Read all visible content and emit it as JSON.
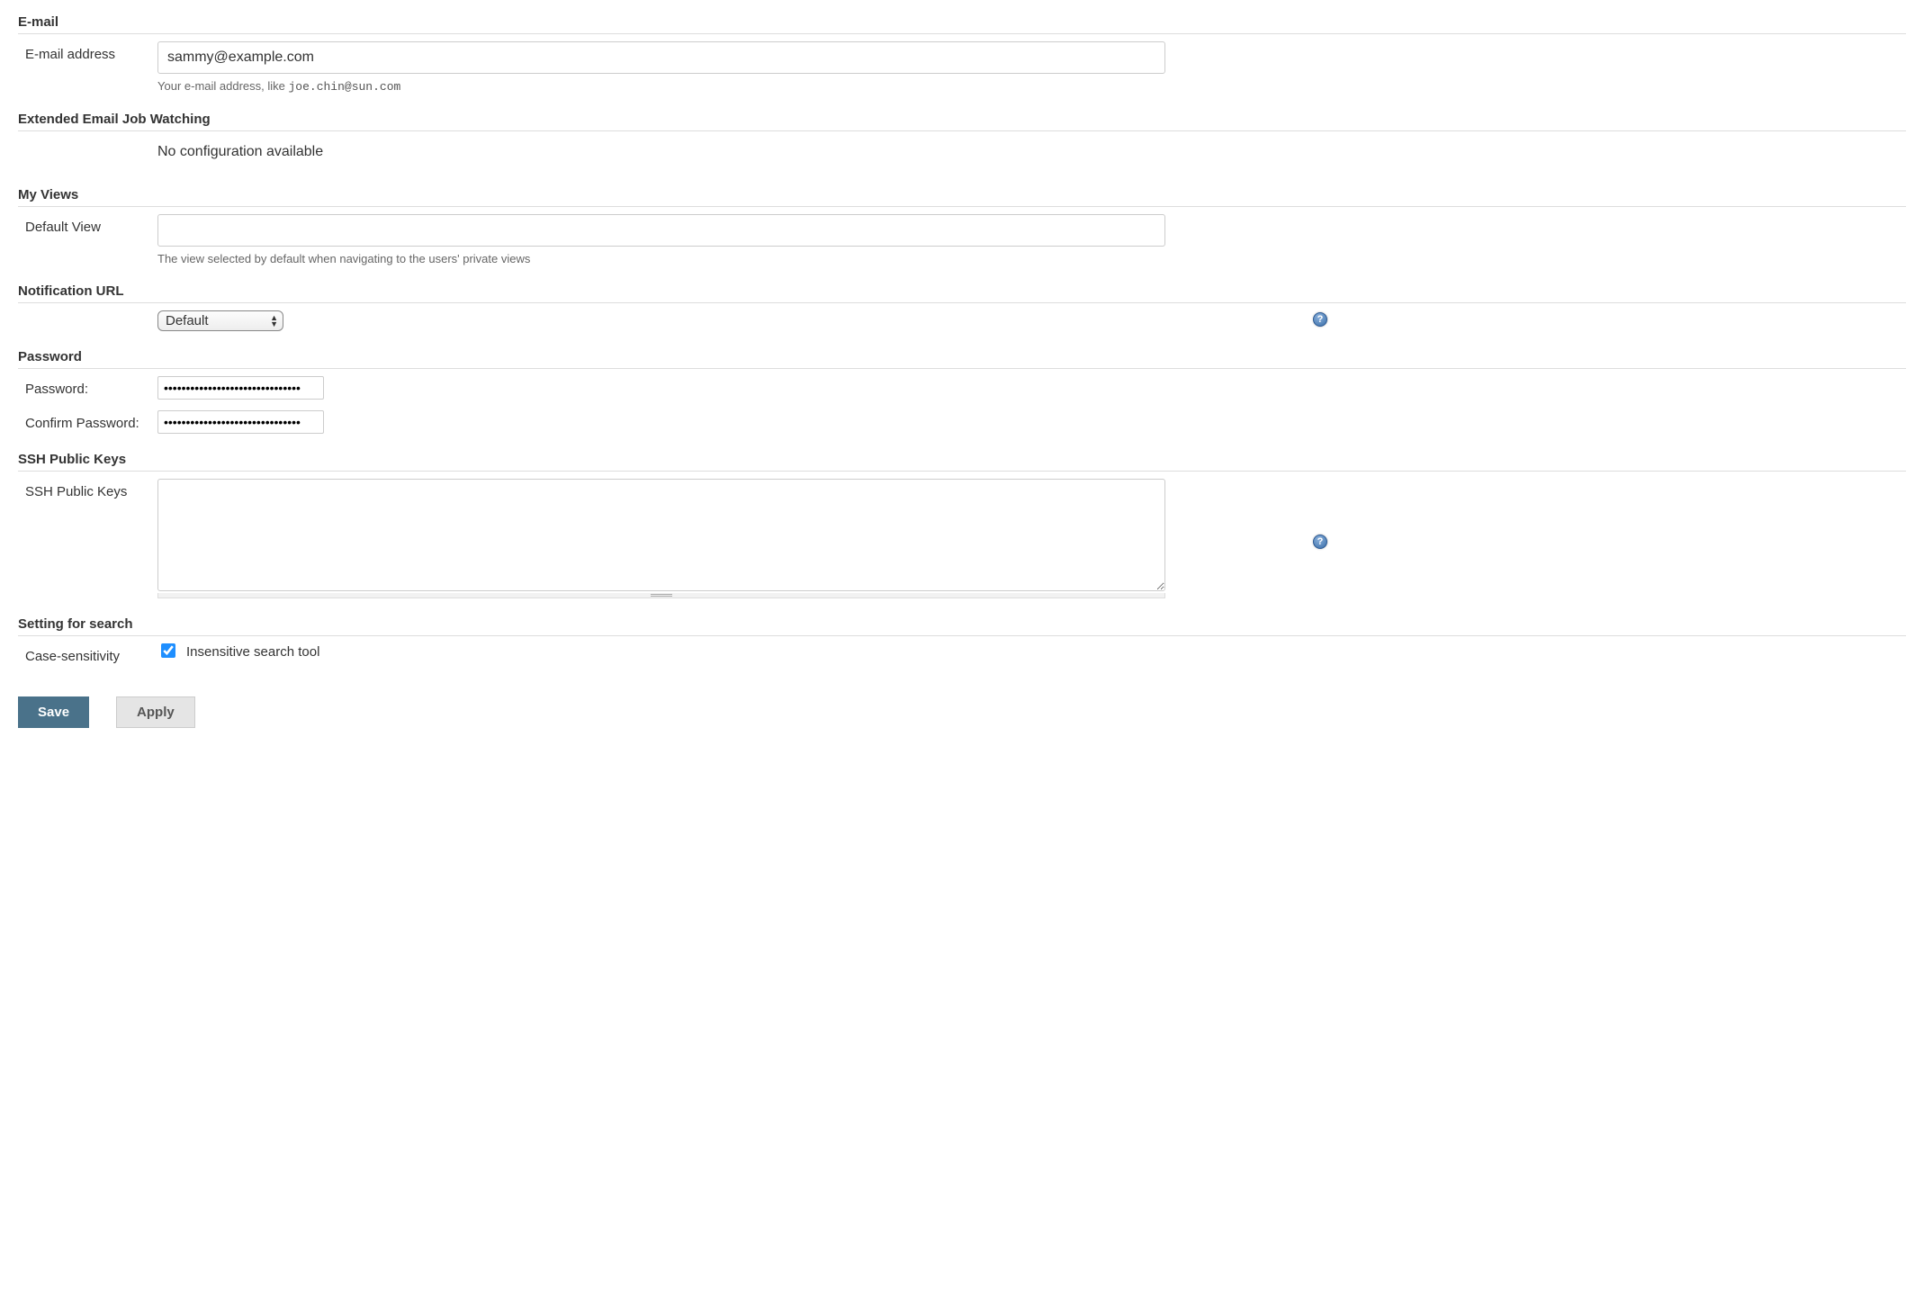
{
  "sections": {
    "email": {
      "heading": "E-mail",
      "address_label": "E-mail address",
      "address_value": "sammy@example.com",
      "help_prefix": "Your e-mail address, like ",
      "help_code": "joe.chin@sun.com"
    },
    "extended": {
      "heading": "Extended Email Job Watching",
      "message": "No configuration available"
    },
    "myviews": {
      "heading": "My Views",
      "default_view_label": "Default View",
      "default_view_value": "",
      "help": "The view selected by default when navigating to the users' private views"
    },
    "notification": {
      "heading": "Notification URL",
      "selected": "Default"
    },
    "password": {
      "heading": "Password",
      "password_label": "Password:",
      "confirm_label": "Confirm Password:",
      "password_value": "•••••••••••••••••••••••••••••••",
      "confirm_value": "•••••••••••••••••••••••••••••••"
    },
    "ssh": {
      "heading": "SSH Public Keys",
      "label": "SSH Public Keys",
      "value": ""
    },
    "search": {
      "heading": "Setting for search",
      "case_label": "Case-sensitivity",
      "checkbox_label": "Insensitive search tool",
      "checked": true
    }
  },
  "buttons": {
    "save": "Save",
    "apply": "Apply"
  }
}
